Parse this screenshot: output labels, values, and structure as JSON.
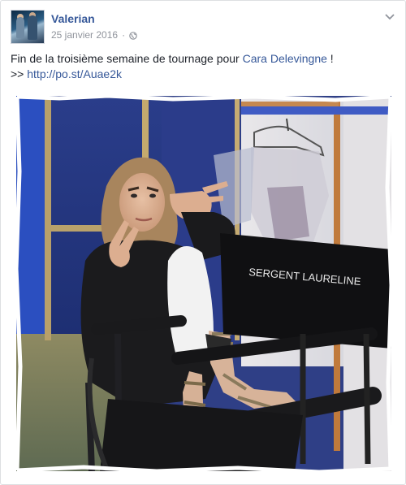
{
  "post": {
    "author": "Valerian",
    "date": "25 janvier 2016",
    "separator": "·",
    "privacy_icon": "globe-icon",
    "menu_icon": "chevron-down-icon",
    "text_prefix": "Fin de la troisième semaine de tournage pour ",
    "mention": "Cara Delevingne",
    "text_suffix": " !",
    "link_prefix": ">> ",
    "link": "http://po.st/Auae2k"
  },
  "photo": {
    "chair_label": "SERGENT LAURELINE"
  },
  "colors": {
    "link": "#365899",
    "meta": "#90949c",
    "border": "#dddfe2"
  }
}
